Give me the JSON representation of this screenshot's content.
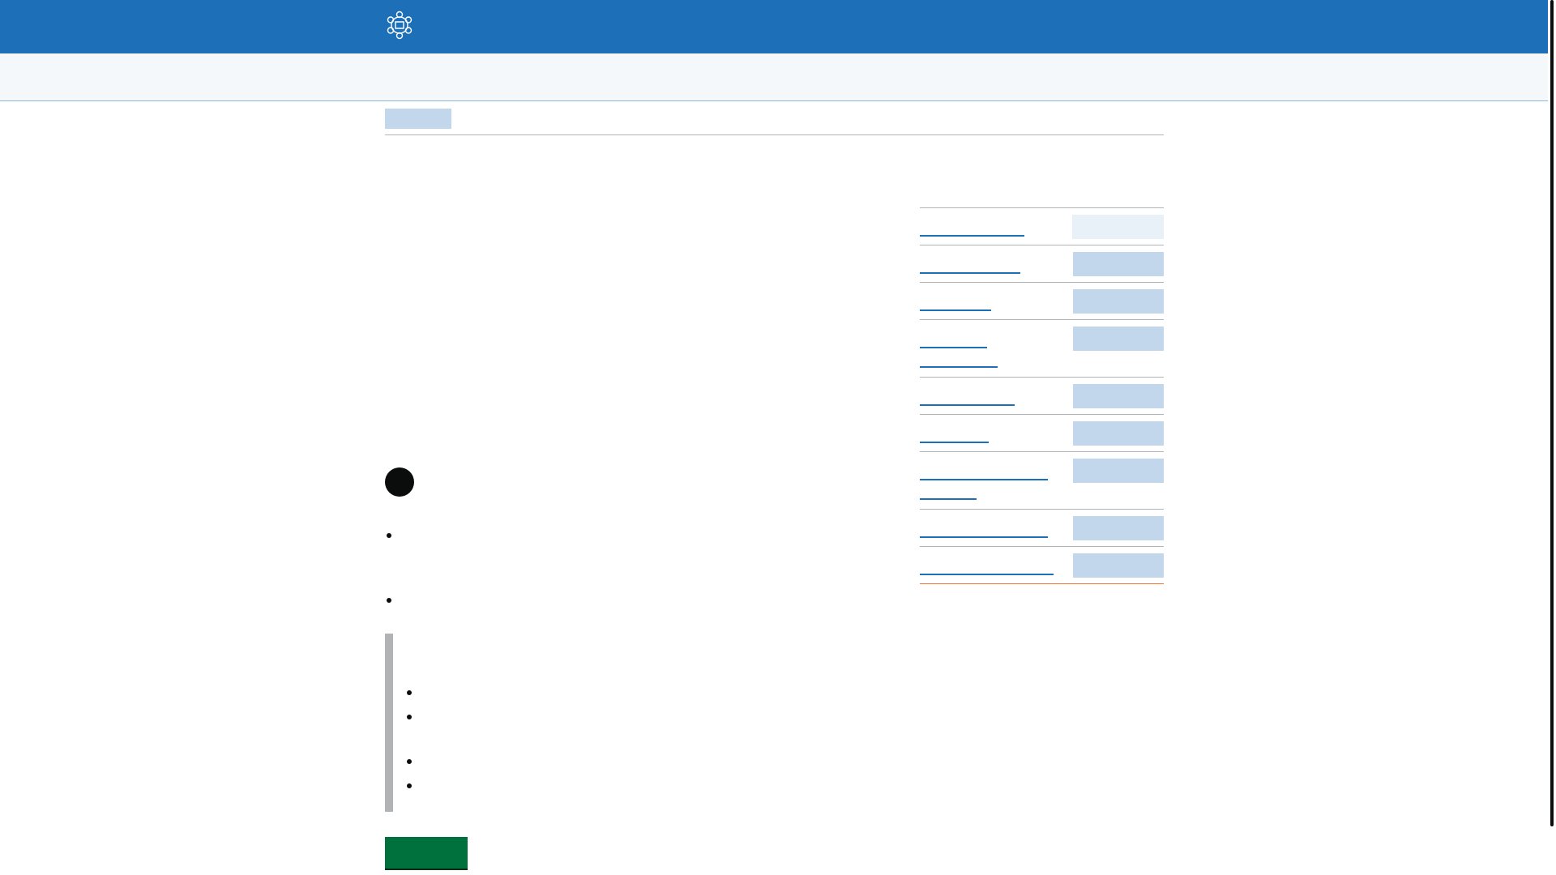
{
  "header": {
    "logo_icon": "crest-icon",
    "brand_color": "#1d70b8"
  },
  "breadcrumb": {
    "items": []
  },
  "side_navigation": {
    "items": [
      {
        "label": "",
        "current": true
      },
      {
        "label": "",
        "current": false
      },
      {
        "label": "",
        "current": false
      },
      {
        "label": "",
        "current": false
      },
      {
        "label": "",
        "current": false
      },
      {
        "label": "",
        "current": false
      },
      {
        "label": "",
        "current": false
      },
      {
        "label": "",
        "current": false
      },
      {
        "label": "",
        "current": false
      }
    ]
  },
  "content": {
    "avatar_icon": "avatar-icon"
  },
  "actions": {
    "start_label": "",
    "start_color": "#00703c"
  }
}
